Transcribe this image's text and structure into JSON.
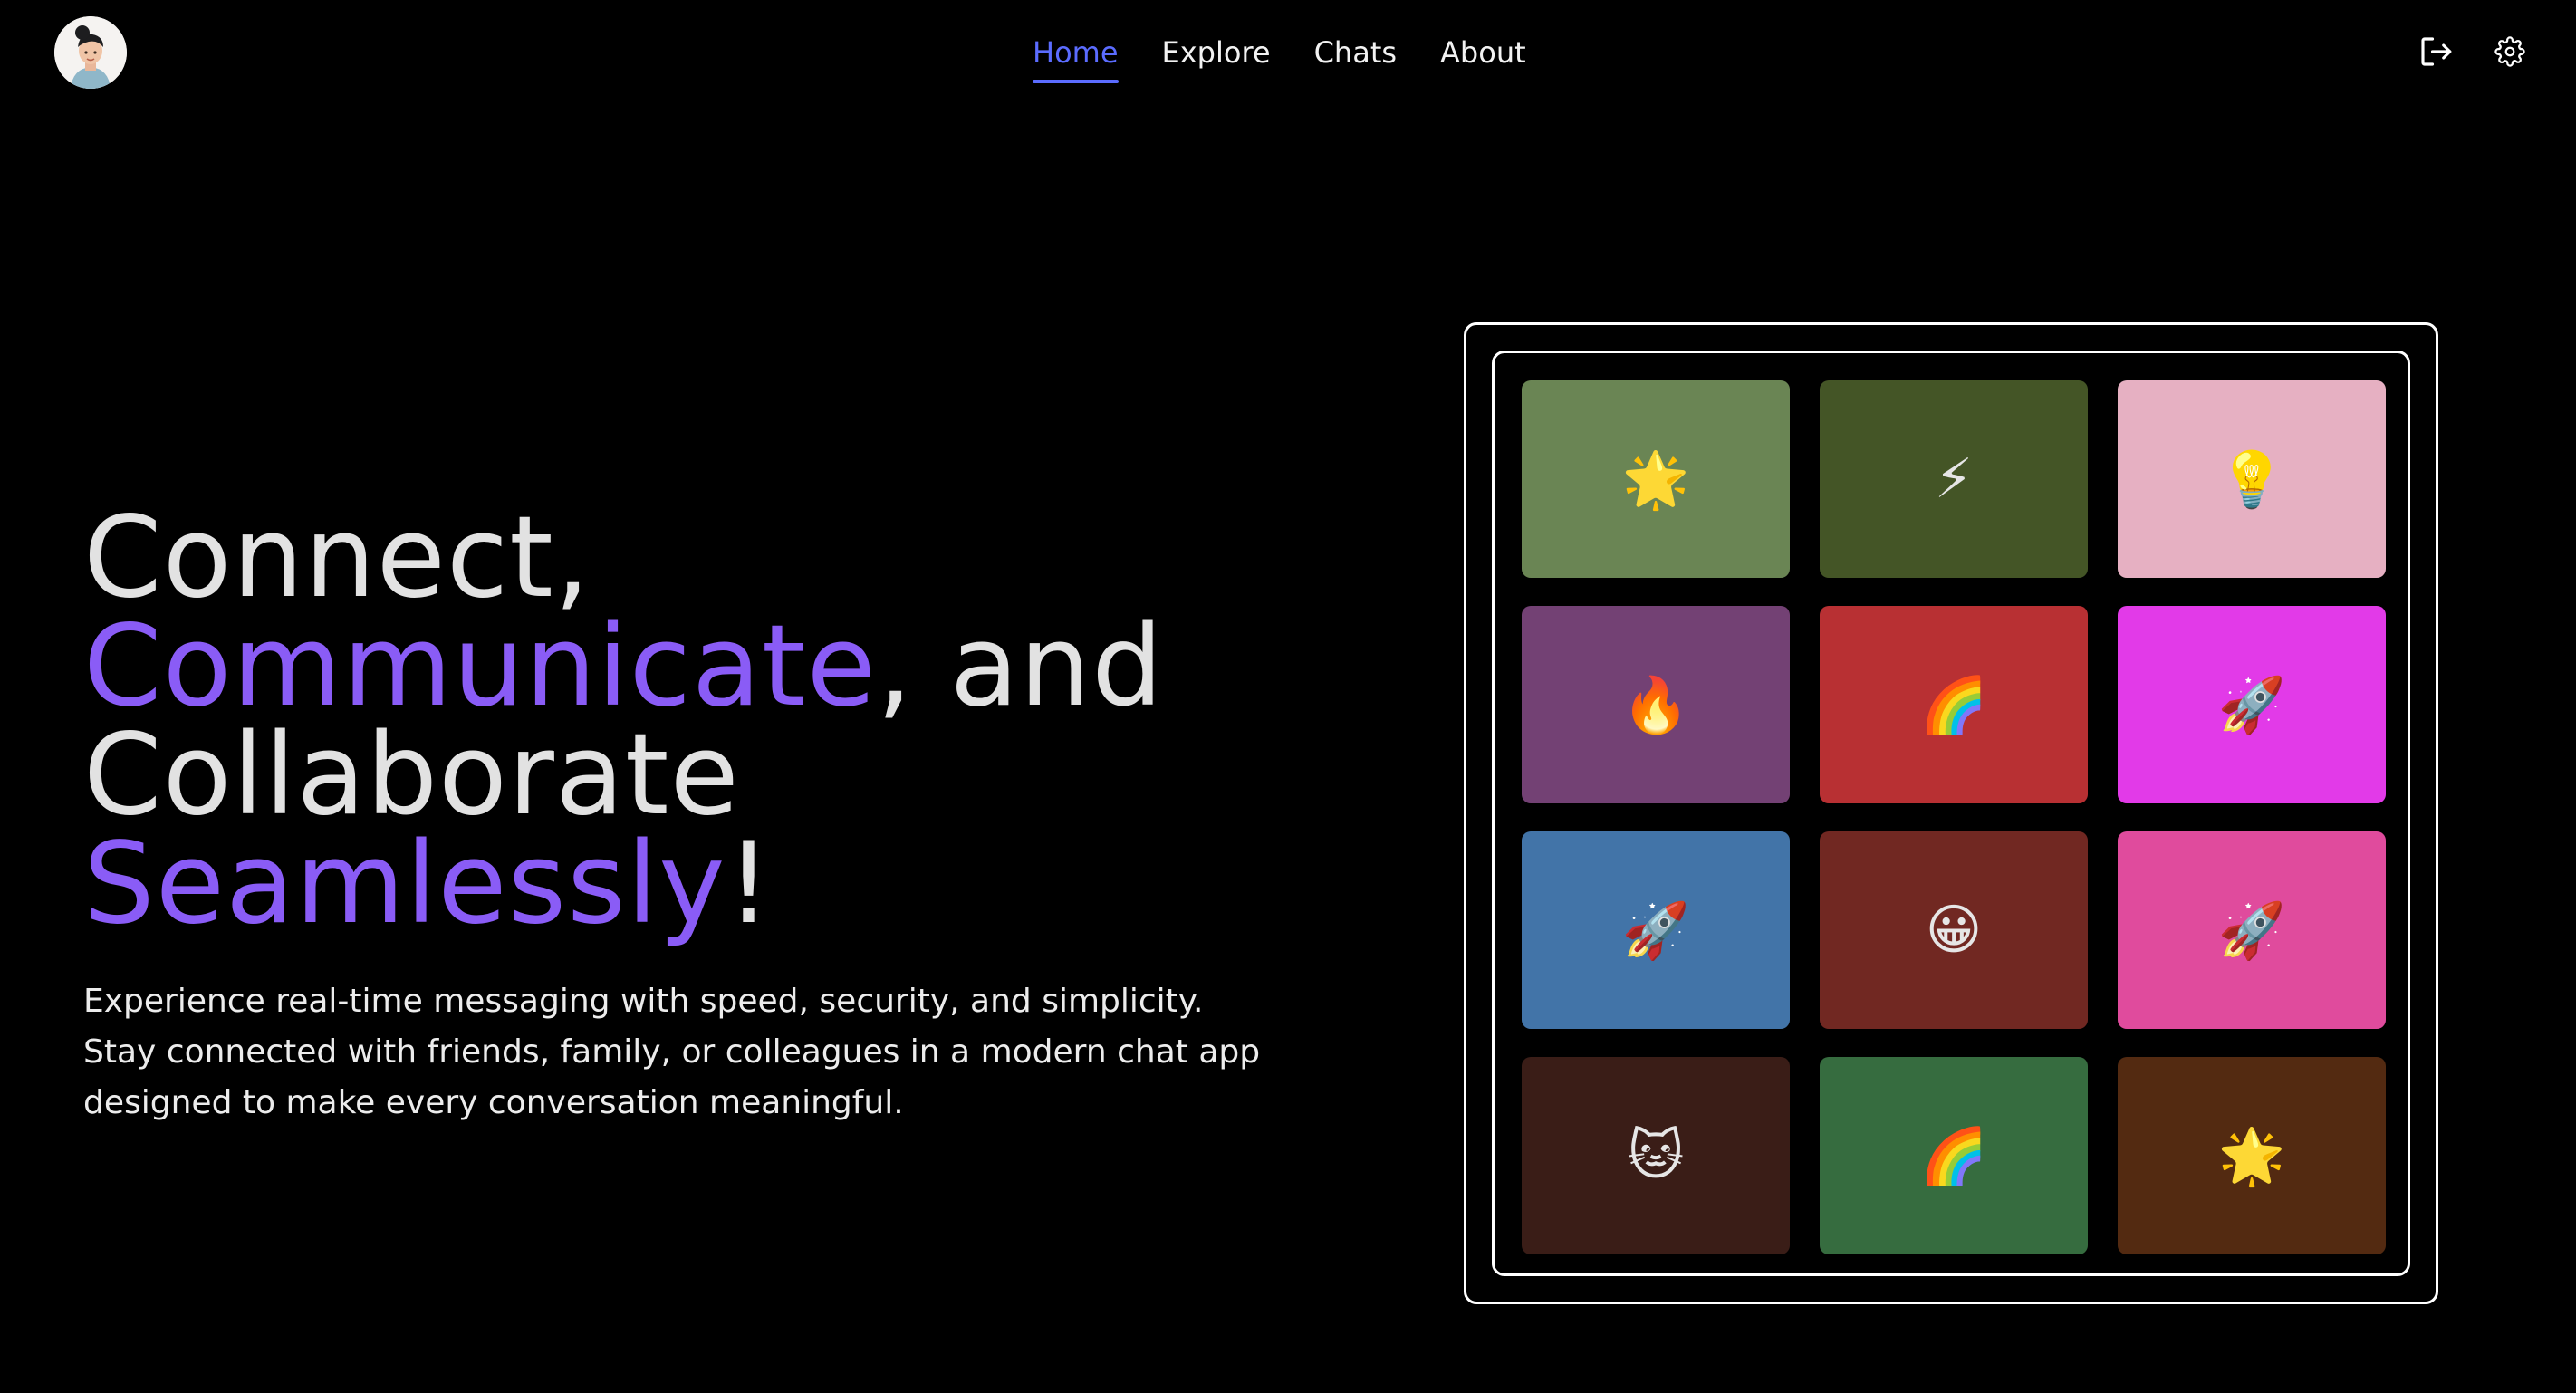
{
  "header": {
    "avatar_icon": "user-avatar",
    "nav": [
      {
        "label": "Home",
        "active": true
      },
      {
        "label": "Explore",
        "active": false
      },
      {
        "label": "Chats",
        "active": false
      },
      {
        "label": "About",
        "active": false
      }
    ],
    "icons": [
      "logout-icon",
      "gear-icon"
    ],
    "accent_color": "#5b6cff"
  },
  "hero": {
    "line1": "Connect,",
    "line2_accent": "Communicate",
    "line2_rest": ", and",
    "line3": "Collaborate",
    "line4_accent": "Seamlessly",
    "line4_rest": "!",
    "description": "Experience real-time messaging with speed, security, and simplicity. Stay connected with friends, family, or colleagues in a modern chat app designed to make every conversation meaningful.",
    "accent_color": "#8a5cf6"
  },
  "tiles": [
    {
      "emoji": "🌟",
      "color": "#6a8554"
    },
    {
      "emoji": "⚡",
      "color": "#445526"
    },
    {
      "emoji": "💡",
      "color": "#e6b0c2"
    },
    {
      "emoji": "🔥",
      "color": "#734174"
    },
    {
      "emoji": "🌈",
      "color": "#b83033"
    },
    {
      "emoji": "🚀",
      "color": "#e23ae8"
    },
    {
      "emoji": "🚀",
      "color": "#4274a8"
    },
    {
      "emoji": "😀",
      "color": "#712822"
    },
    {
      "emoji": "🚀",
      "color": "#e04b9d"
    },
    {
      "emoji": "🐱",
      "color": "#3a1d17"
    },
    {
      "emoji": "🌈",
      "color": "#366c3f"
    },
    {
      "emoji": "🌟",
      "color": "#532a11"
    }
  ]
}
